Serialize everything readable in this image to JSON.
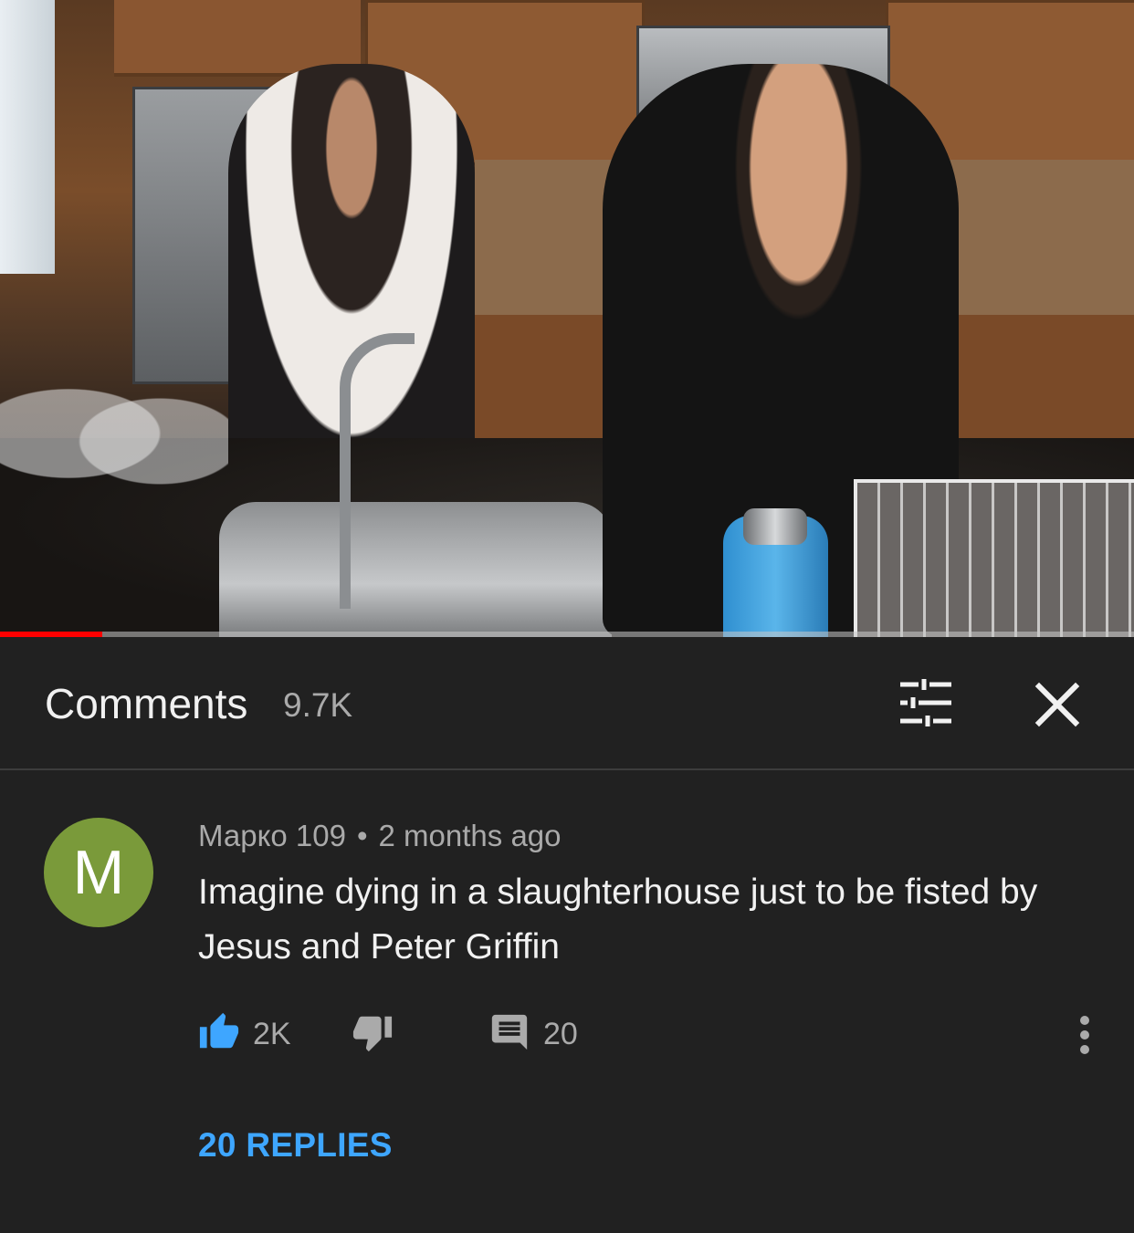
{
  "video": {
    "progress_fraction": 0.09,
    "played_color": "#ff0000"
  },
  "comments_header": {
    "title": "Comments",
    "count": "9.7K",
    "filter_icon": "sort-filter-icon",
    "close_icon": "close-icon"
  },
  "comment": {
    "avatar_letter": "M",
    "avatar_color": "#7a9a3a",
    "author": "Марко 109",
    "separator": "•",
    "time": "2 months ago",
    "text": "Imagine dying in a slaughterhouse just to be fisted by Jesus and Peter Griffin",
    "likes": "2K",
    "like_icon": "thumbs-up-icon",
    "dislike_icon": "thumbs-down-icon",
    "reply_icon": "comment-icon",
    "reply_count": "20",
    "more_icon": "more-vertical-icon",
    "replies_link": "20 REPLIES"
  },
  "colors": {
    "background": "#212121",
    "link_blue": "#3ea6ff",
    "secondary_text": "#aaaaaa"
  }
}
